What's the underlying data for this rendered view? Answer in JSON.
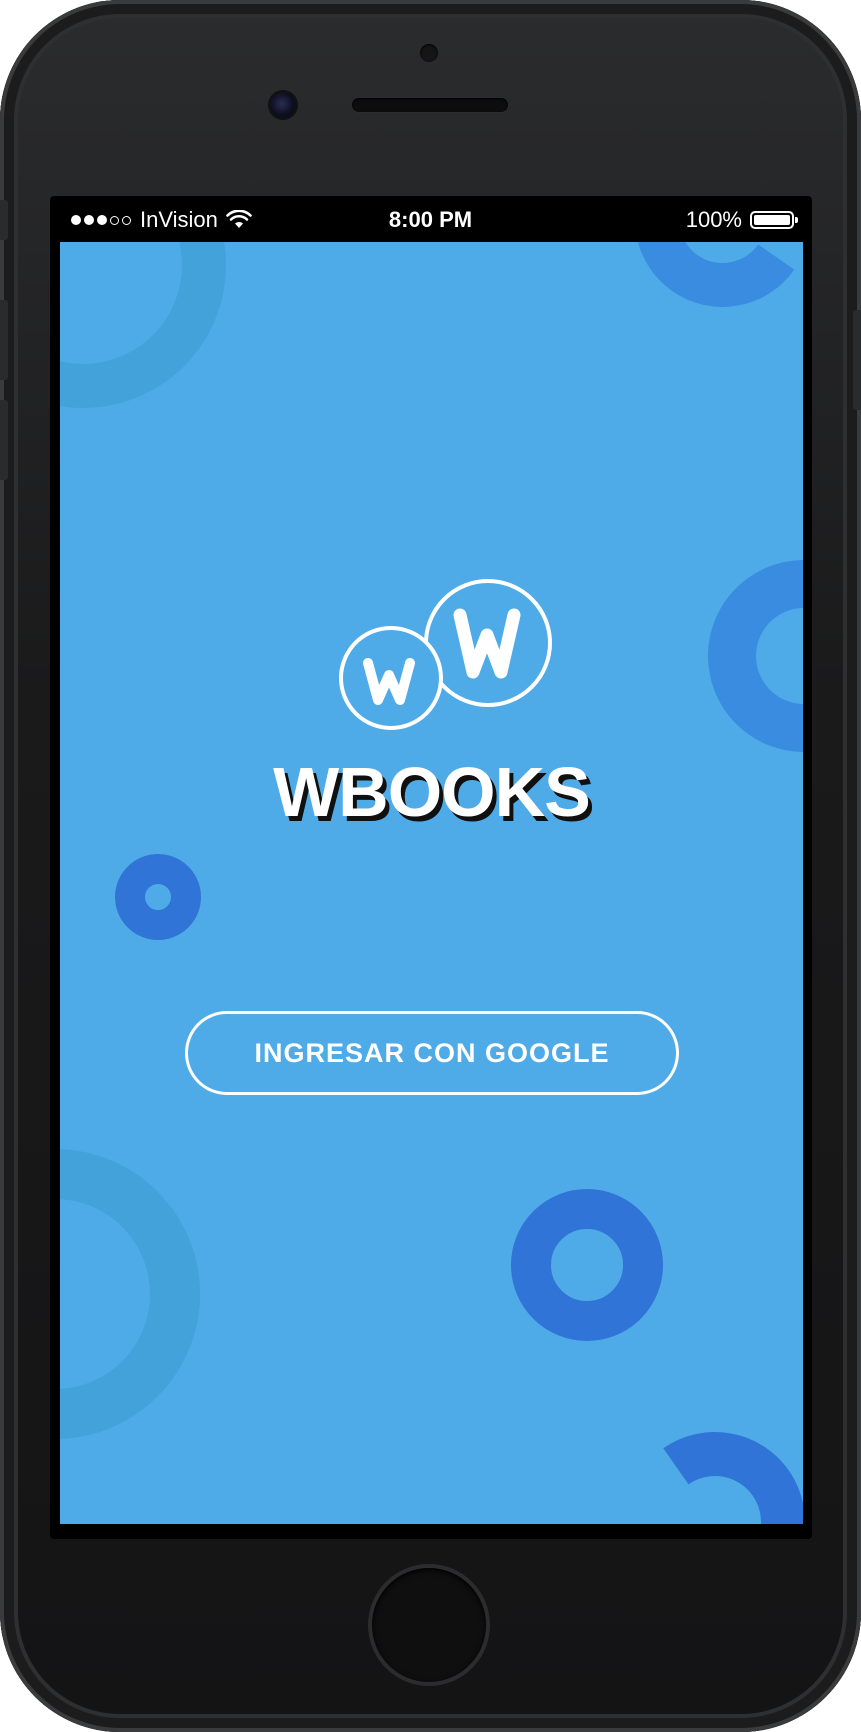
{
  "status_bar": {
    "signal_bars_filled": 3,
    "signal_bars_total": 5,
    "carrier": "InVision",
    "time": "8:00 PM",
    "battery_percent": "100%",
    "battery_level": 1.0
  },
  "app": {
    "brand_name": "WBOOKS",
    "login_button_label": "INGRESAR CON GOOGLE"
  },
  "colors": {
    "screen_background": "#4eabe8",
    "decoration_light": "#42a2d9",
    "decoration_dark": "#3a8ce0",
    "decoration_deep": "#2f74d6",
    "text": "#ffffff"
  },
  "icons": {
    "logo": "wbooks-double-w-logo-icon",
    "wifi": "wifi-icon",
    "battery": "battery-icon"
  }
}
